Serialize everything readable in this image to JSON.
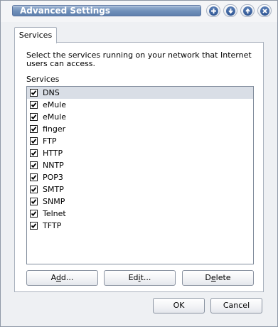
{
  "window": {
    "title": "Advanced Settings",
    "controls": [
      {
        "name": "plus-icon"
      },
      {
        "name": "arrow-down-icon"
      },
      {
        "name": "arrow-up-icon"
      },
      {
        "name": "close-icon"
      }
    ]
  },
  "tabs": [
    {
      "label": "Services",
      "active": true
    }
  ],
  "panel": {
    "description": "Select the services running on your network that Internet users can access.",
    "list_label": "Services",
    "services": [
      {
        "label": "DNS",
        "checked": true,
        "selected": true
      },
      {
        "label": "eMule",
        "checked": true,
        "selected": false
      },
      {
        "label": "eMule",
        "checked": true,
        "selected": false
      },
      {
        "label": "finger",
        "checked": true,
        "selected": false
      },
      {
        "label": "FTP",
        "checked": true,
        "selected": false
      },
      {
        "label": "HTTP",
        "checked": true,
        "selected": false
      },
      {
        "label": "NNTP",
        "checked": true,
        "selected": false
      },
      {
        "label": "POP3",
        "checked": true,
        "selected": false
      },
      {
        "label": "SMTP",
        "checked": true,
        "selected": false
      },
      {
        "label": "SNMP",
        "checked": true,
        "selected": false
      },
      {
        "label": "Telnet",
        "checked": true,
        "selected": false
      },
      {
        "label": "TFTP",
        "checked": true,
        "selected": false
      }
    ],
    "buttons": {
      "add": {
        "before": "A",
        "mnemonic": "d",
        "after": "d..."
      },
      "edit": {
        "before": "Ed",
        "mnemonic": "i",
        "after": "t..."
      },
      "delete": {
        "before": "D",
        "mnemonic": "e",
        "after": "lete"
      }
    }
  },
  "dialog_buttons": {
    "ok": "OK",
    "cancel": "Cancel"
  },
  "colors": {
    "title_bar": "#6f8fb9",
    "selection": "#d9dee6",
    "window_bg": "#eef0f3"
  }
}
